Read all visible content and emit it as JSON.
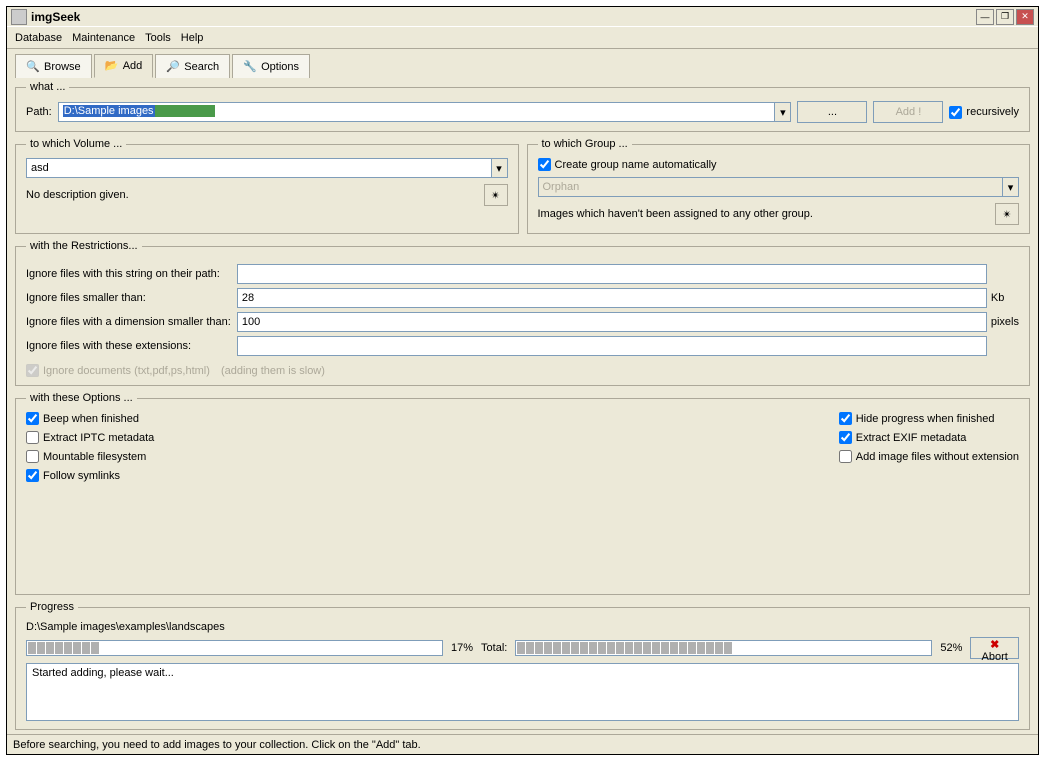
{
  "title": "imgSeek",
  "menu": [
    "Database",
    "Maintenance",
    "Tools",
    "Help"
  ],
  "tabs": [
    "Browse",
    "Add",
    "Search",
    "Options"
  ],
  "what": {
    "legend": "what ...",
    "path_label": "Path:",
    "path_value": "D:\\Sample images",
    "browse_btn": "...",
    "add_btn": "Add !",
    "recursively_label": "recursively"
  },
  "volume": {
    "legend": "to which Volume ...",
    "selected": "asd",
    "desc": "No description given."
  },
  "group": {
    "legend": "to which Group ...",
    "auto_label": "Create group name automatically",
    "selected": "Orphan",
    "desc": "Images which haven't been assigned to any other group."
  },
  "restrictions": {
    "legend": "with the Restrictions...",
    "ignore_path_label": "Ignore files with this string on their path:",
    "ignore_path_value": "",
    "ignore_smaller_label": "Ignore files smaller than:",
    "ignore_smaller_value": "28",
    "ignore_smaller_unit": "Kb",
    "ignore_dim_label": "Ignore files with a dimension smaller than:",
    "ignore_dim_value": "100",
    "ignore_dim_unit": "pixels",
    "ignore_ext_label": "Ignore files with these extensions:",
    "ignore_ext_value": "",
    "ignore_docs_label": "Ignore documents (txt,pdf,ps,html)",
    "ignore_docs_hint": "(adding them is slow)"
  },
  "options": {
    "legend": "with these Options ...",
    "beep": "Beep when finished",
    "iptc": "Extract IPTC metadata",
    "mountable": "Mountable filesystem",
    "symlinks": "Follow symlinks",
    "hide_progress": "Hide progress when finished",
    "exif": "Extract EXIF metadata",
    "noext": "Add image files without extension"
  },
  "progress": {
    "legend": "Progress",
    "current_path": "D:\\Sample images\\examples\\landscapes",
    "current_percent": "17%",
    "total_label": "Total:",
    "total_percent": "52%",
    "abort": "Abort",
    "log": "Started adding, please wait..."
  },
  "status": "Before searching, you need to add images to your collection. Click on the \"Add\" tab."
}
